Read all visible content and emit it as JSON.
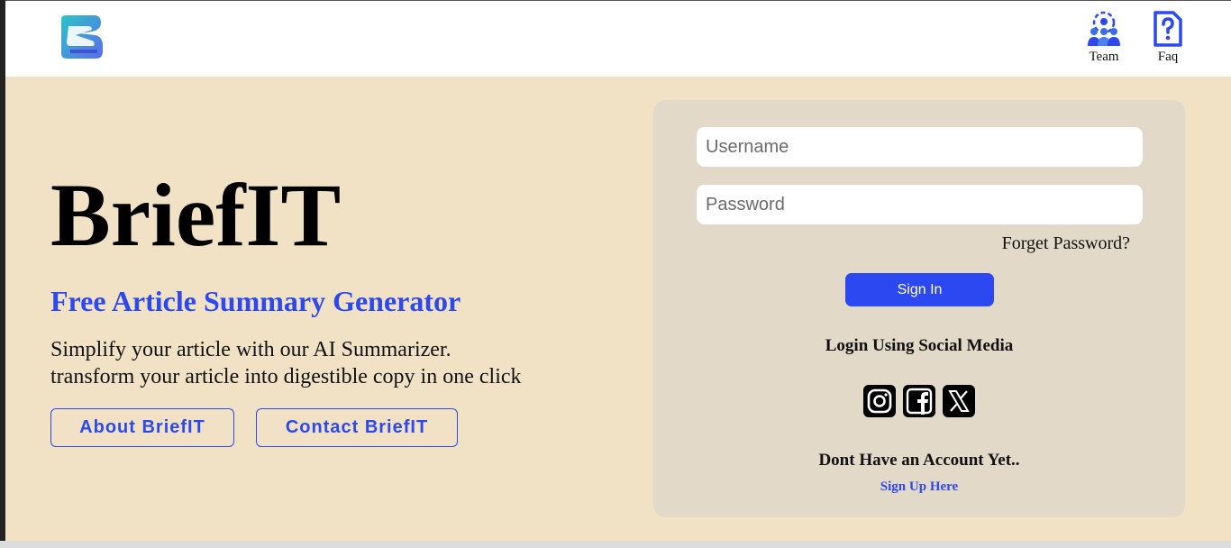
{
  "nav": {
    "logo_icon": "brief-it-logo-icon",
    "items": [
      {
        "label": "Team",
        "icon": "team-gear-icon"
      },
      {
        "label": "Faq",
        "icon": "faq-document-icon"
      }
    ]
  },
  "hero": {
    "title": "BriefIT",
    "subtitle": "Free Article Summary Generator",
    "description_lines": [
      "Simplify your article with our AI Summarizer.",
      "transform your article into digestible copy in one click"
    ],
    "buttons": {
      "about": "About BriefIT",
      "contact": "Contact BriefIT"
    }
  },
  "login": {
    "username_placeholder": "Username",
    "password_placeholder": "Password",
    "forget_password": "Forget Password?",
    "sign_in": "Sign In",
    "social_title": "Login Using Social Media",
    "social_icons": [
      "instagram-icon",
      "facebook-icon",
      "x-twitter-icon"
    ],
    "no_account": "Dont Have an Account Yet..",
    "sign_up": "Sign Up Here"
  },
  "colors": {
    "accent": "#2c48f0",
    "page_background": "#f1e2c6",
    "card_background": "#e2d9c8",
    "nav_background": "#ffffff"
  }
}
